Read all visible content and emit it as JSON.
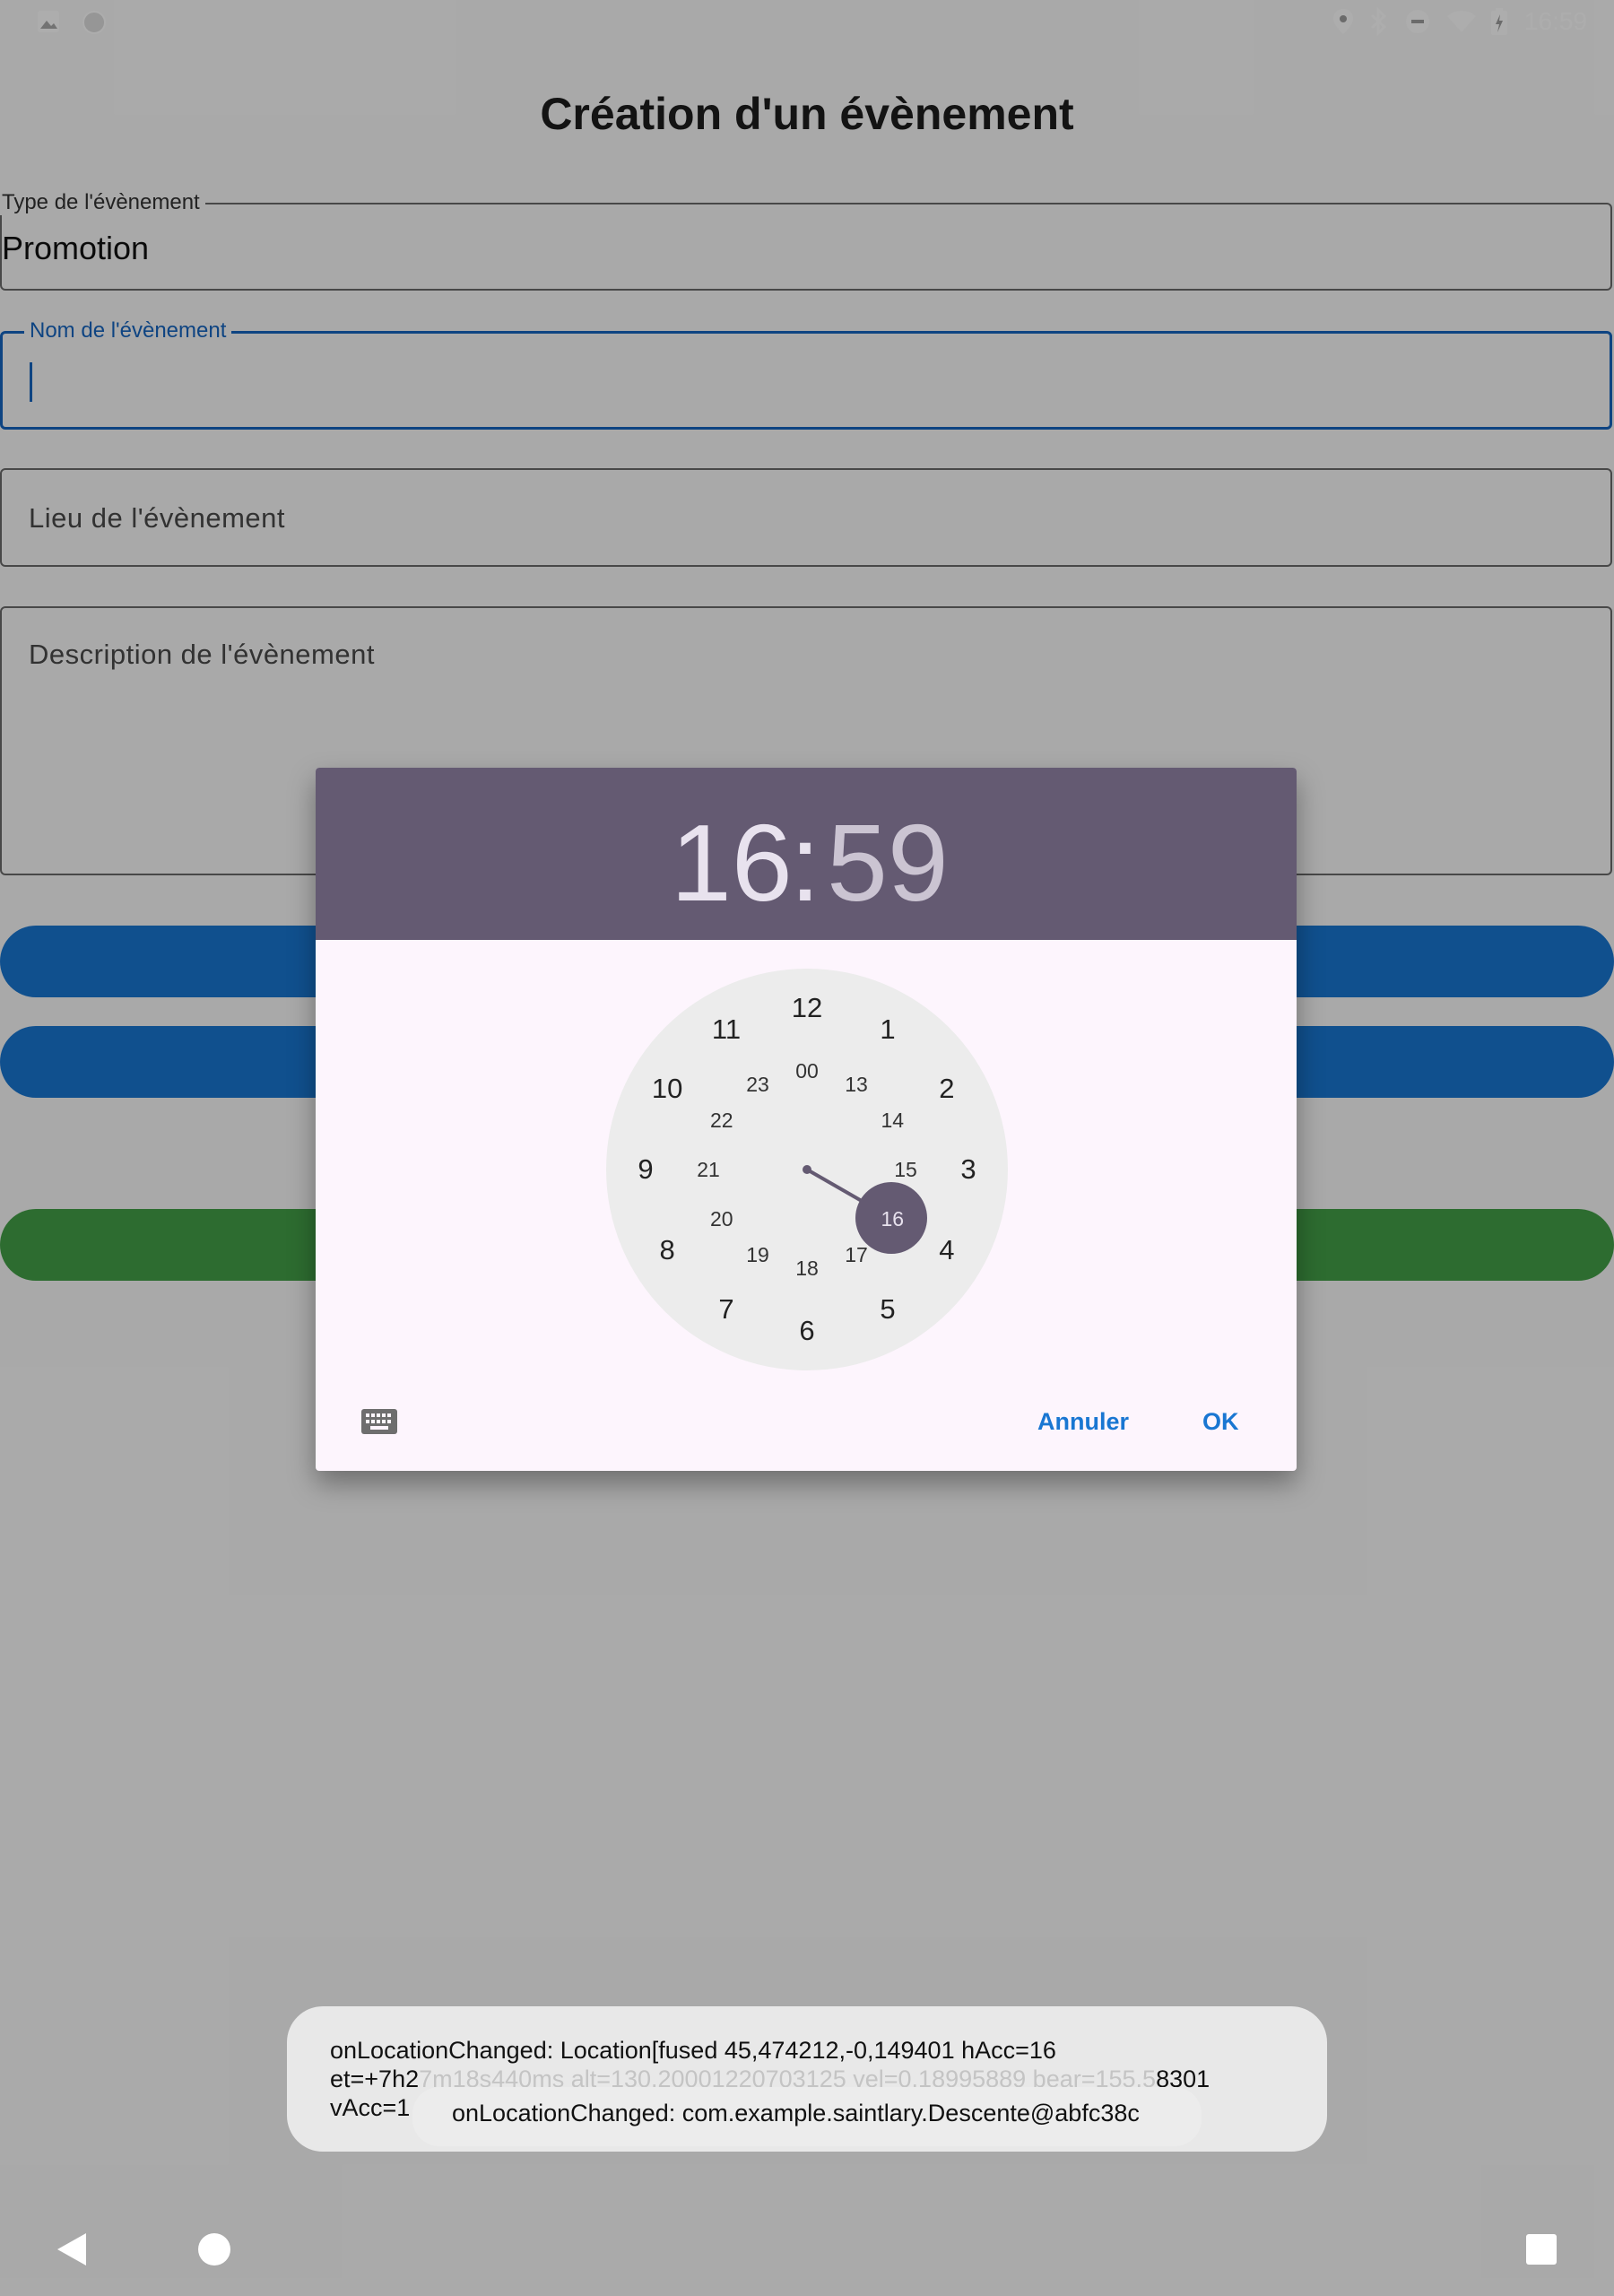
{
  "status_bar": {
    "time": "16:59",
    "left_icons": [
      "image-icon",
      "circle-icon"
    ],
    "right_icons": [
      "location-icon",
      "bluetooth-icon",
      "do-not-disturb-icon",
      "wifi-icon",
      "battery-icon"
    ]
  },
  "page": {
    "title": "Création d'un évènement",
    "fields": {
      "type": {
        "label": "Type de l'évènement",
        "value": "Promotion"
      },
      "name": {
        "label": "Nom de l'évènement",
        "value": ""
      },
      "place": {
        "placeholder": "Lieu de l'évènement"
      },
      "description": {
        "placeholder": "Description de l'évènement"
      }
    },
    "colors": {
      "primary": "#1976d2",
      "green": "#43a047",
      "focus": "#1565c0"
    }
  },
  "time_picker": {
    "hour": "16",
    "separator": ":",
    "minute": "59",
    "selected_hour": "16",
    "outer_numbers": [
      "12",
      "1",
      "2",
      "3",
      "4",
      "5",
      "6",
      "7",
      "8",
      "9",
      "10",
      "11"
    ],
    "inner_numbers": [
      "00",
      "13",
      "14",
      "15",
      "16",
      "17",
      "18",
      "19",
      "20",
      "21",
      "22",
      "23"
    ],
    "cancel_label": "Annuler",
    "ok_label": "OK",
    "keyboard_icon": "keyboard-icon",
    "header_color": "#645a72"
  },
  "toast": {
    "line1": "onLocationChanged: Location[fused 45,474212,-0,149401 hAcc=16",
    "line2_left": "et=+7h2",
    "line2_faded": "7m18s440ms alt=130.20001220703125 vel=0.18995889 bear=155.5",
    "line2_right": "8301",
    "line3_left": "vAcc=1",
    "line3_faded": "sA",
    "overlay_text": "onLocationChanged: com.example.saintlary.Descente@abfc38c"
  },
  "nav_bar": {
    "icons": [
      "back-icon",
      "home-icon",
      "recents-icon"
    ]
  }
}
